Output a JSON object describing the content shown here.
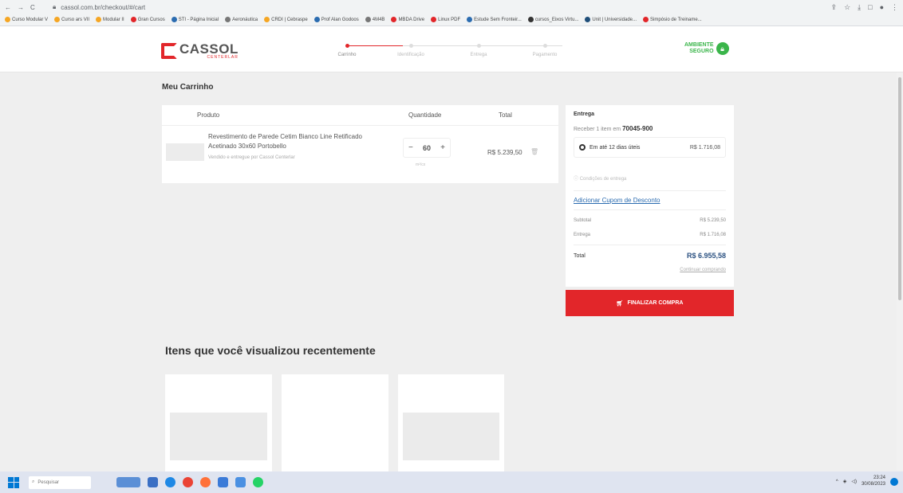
{
  "browser": {
    "url": "cassol.com.br/checkout/#/cart",
    "bookmarks": [
      "Curso Modular V",
      "Curso ars VII",
      "Modular II",
      "Gran Cursos",
      "STI - Página Inicial",
      "Aeronáutica",
      "CRDI | Cebraspe",
      "Prof Alan Godoos",
      "4M4B",
      "MBDA Drive",
      "Linux PDF",
      "Estude Sem Fronteir...",
      "cursos_Eixos Virtu...",
      "Unit | Universidade...",
      "Simpósio de Treiname..."
    ]
  },
  "header": {
    "logo_name": "CASSOL",
    "logo_sub": "CENTERLAR",
    "steps": [
      "Carrinho",
      "Identificação",
      "Entrega",
      "Pagamento"
    ],
    "secure_line1": "AMBIENTE",
    "secure_line2": "SEGURO"
  },
  "cart": {
    "title": "Meu Carrinho",
    "columns": {
      "product": "Produto",
      "quantity": "Quantidade",
      "total": "Total"
    },
    "item": {
      "name": "Revestimento de Parede Cetim Bianco Line Retificado Acetinado 30x60 Portobello",
      "seller": "Vendido e entregue por Cassol Centerlar",
      "quantity": "60",
      "unit": "m²/cx",
      "total": "R$ 5.239,50"
    }
  },
  "delivery": {
    "title": "Entrega",
    "receive_prefix": "Receber 1 item em",
    "cep": "70045-900",
    "option_label": "Em até 12 dias úteis",
    "option_price": "R$ 1.716,08",
    "conditions": "Condições de entrega",
    "coupon": "Adicionar Cupom de Desconto",
    "subtotal_label": "Subtotal",
    "subtotal_value": "R$ 5.239,50",
    "shipping_label": "Entrega",
    "shipping_value": "R$ 1.716,08",
    "total_label": "Total",
    "total_value": "R$ 6.955,58",
    "continue": "Continuar comprando",
    "buy_button": "FINALIZAR COMPRA"
  },
  "recent": {
    "title": "Itens que você visualizou recentemente"
  },
  "taskbar": {
    "search": "Pesquisar",
    "time": "23:24",
    "date": "30/08/2023"
  }
}
